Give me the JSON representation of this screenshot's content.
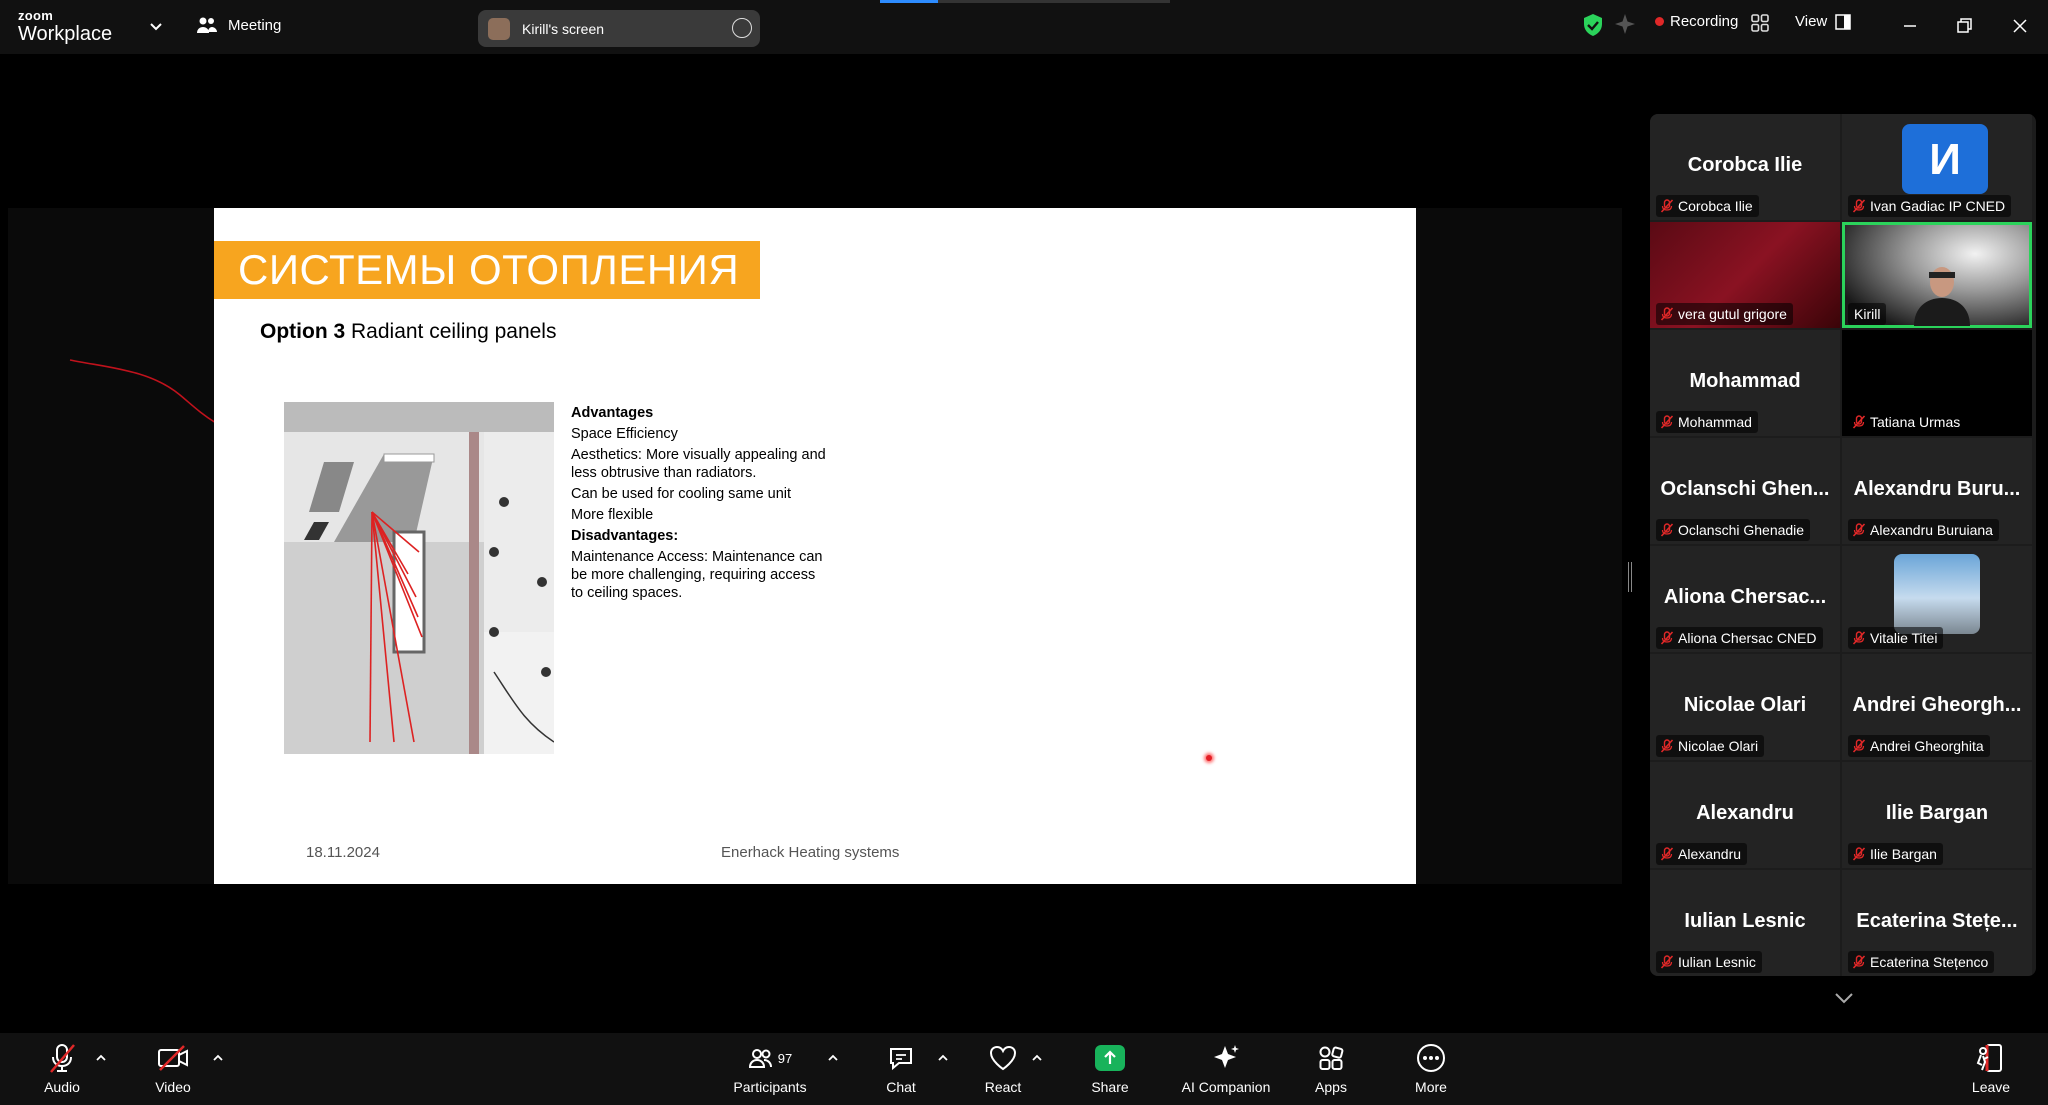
{
  "app": {
    "brand_small": "zoom",
    "brand_big": "Workplace",
    "meeting_label": "Meeting"
  },
  "screen_share": {
    "label": "Kirill's screen"
  },
  "status": {
    "recording": "Recording",
    "view": "View"
  },
  "slide": {
    "title": "СИСТЕМЫ ОТОПЛЕНИЯ",
    "option_bold": "Option 3",
    "option_rest": " Radiant ceiling panels",
    "advantages_heading": "Advantages",
    "advantages": [
      "Space Efficiency",
      "Aesthetics: More visually appealing and less obtrusive than radiators.",
      "Can be used for cooling same unit",
      "More flexible"
    ],
    "disadvantages_heading": "Disadvantages:",
    "disadvantages": [
      "Maintenance Access: Maintenance can be more challenging, requiring access to ceiling spaces."
    ],
    "footer_date": "18.11.2024",
    "footer_name": "Enerhack Heating systems"
  },
  "gallery": {
    "tiles": [
      {
        "big": "Corobca Ilie",
        "label": "Corobca Ilie",
        "muted": true
      },
      {
        "initial": "И",
        "label": "Ivan Gadiac IP CNED",
        "muted": true
      },
      {
        "video": "dark-red",
        "label": "vera gutul grigore",
        "muted": true
      },
      {
        "video": "person",
        "label": "Kirill",
        "muted": false,
        "active": true
      },
      {
        "big": "Mohammad",
        "label": "Mohammad",
        "muted": true
      },
      {
        "video": "black",
        "label": "Tatiana Urmas",
        "muted": true
      },
      {
        "big": "Oclanschi Ghen...",
        "label": "Oclanschi Ghenadie",
        "muted": true
      },
      {
        "big": "Alexandru Buru...",
        "label": "Alexandru Buruiana",
        "muted": true
      },
      {
        "big": "Aliona Chersac...",
        "label": "Aliona Chersac CNED",
        "muted": true
      },
      {
        "photo": true,
        "label": "Vitalie Titei",
        "muted": true
      },
      {
        "big": "Nicolae Olari",
        "label": "Nicolae Olari",
        "muted": true
      },
      {
        "big": "Andrei Gheorgh...",
        "label": "Andrei Gheorghita",
        "muted": true
      },
      {
        "big": "Alexandru",
        "label": "Alexandru",
        "muted": true
      },
      {
        "big": "Ilie Bargan",
        "label": "Ilie Bargan",
        "muted": true
      },
      {
        "big": "Iulian Lesnic",
        "label": "Iulian Lesnic",
        "muted": true
      },
      {
        "big": "Ecaterina Stețe...",
        "label": "Ecaterina Stețenco",
        "muted": true
      }
    ]
  },
  "toolbar": {
    "audio": "Audio",
    "video": "Video",
    "participants": "Participants",
    "participants_count": "97",
    "chat": "Chat",
    "react": "React",
    "share": "Share",
    "ai_companion": "AI Companion",
    "apps": "Apps",
    "more": "More",
    "leave": "Leave"
  },
  "colors": {
    "accent_orange": "#f7a51f",
    "share_green": "#18b35b",
    "active_border": "#2bd35b",
    "mute_red": "#e02828"
  }
}
